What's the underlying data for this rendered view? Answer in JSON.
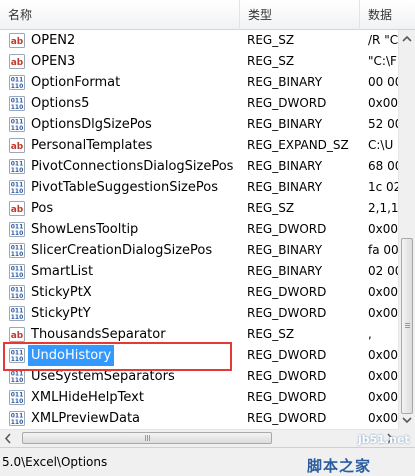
{
  "columns": {
    "name": "名称",
    "type": "类型",
    "data": "数据"
  },
  "rows": [
    {
      "name": "OPEN2",
      "type": "REG_SZ",
      "data": "/R \"C",
      "icon": "string-value-icon"
    },
    {
      "name": "OPEN3",
      "type": "REG_SZ",
      "data": "\"C:\\F",
      "icon": "string-value-icon"
    },
    {
      "name": "OptionFormat",
      "type": "REG_BINARY",
      "data": "00 00",
      "icon": "binary-value-icon"
    },
    {
      "name": "Options5",
      "type": "REG_DWORD",
      "data": "0x00",
      "icon": "binary-value-icon"
    },
    {
      "name": "OptionsDlgSizePos",
      "type": "REG_BINARY",
      "data": "52 00",
      "icon": "binary-value-icon"
    },
    {
      "name": "PersonalTemplates",
      "type": "REG_EXPAND_SZ",
      "data": "C:\\U",
      "icon": "string-value-icon"
    },
    {
      "name": "PivotConnectionsDialogSizePos",
      "type": "REG_BINARY",
      "data": "68 00",
      "icon": "binary-value-icon"
    },
    {
      "name": "PivotTableSuggestionSizePos",
      "type": "REG_BINARY",
      "data": "1c 02",
      "icon": "binary-value-icon"
    },
    {
      "name": "Pos",
      "type": "REG_SZ",
      "data": "2,1,1",
      "icon": "string-value-icon"
    },
    {
      "name": "ShowLensTooltip",
      "type": "REG_DWORD",
      "data": "0x00",
      "icon": "binary-value-icon"
    },
    {
      "name": "SlicerCreationDialogSizePos",
      "type": "REG_BINARY",
      "data": "fa 00",
      "icon": "binary-value-icon"
    },
    {
      "name": "SmartList",
      "type": "REG_BINARY",
      "data": "02 00",
      "icon": "binary-value-icon"
    },
    {
      "name": "StickyPtX",
      "type": "REG_DWORD",
      "data": "0x00",
      "icon": "binary-value-icon"
    },
    {
      "name": "StickyPtY",
      "type": "REG_DWORD",
      "data": "0x00",
      "icon": "binary-value-icon"
    },
    {
      "name": "ThousandsSeparator",
      "type": "REG_SZ",
      "data": ",",
      "icon": "string-value-icon"
    },
    {
      "name": "UndoHistory",
      "type": "REG_DWORD",
      "data": "0x00",
      "icon": "binary-value-icon",
      "selected": true
    },
    {
      "name": "UseSystemSeparators",
      "type": "REG_DWORD",
      "data": "0x00",
      "icon": "binary-value-icon"
    },
    {
      "name": "XMLHideHelpText",
      "type": "REG_DWORD",
      "data": "0x00",
      "icon": "binary-value-icon"
    },
    {
      "name": "XMLPreviewData",
      "type": "REG_DWORD",
      "data": "0x00",
      "icon": "binary-value-icon"
    }
  ],
  "status": {
    "path": "5.0\\Excel\\Options"
  },
  "watermark": {
    "site": "jb51.net",
    "name": "脚本之家"
  },
  "colors": {
    "selection": "#3399ff",
    "highlight_box": "#e53935"
  }
}
